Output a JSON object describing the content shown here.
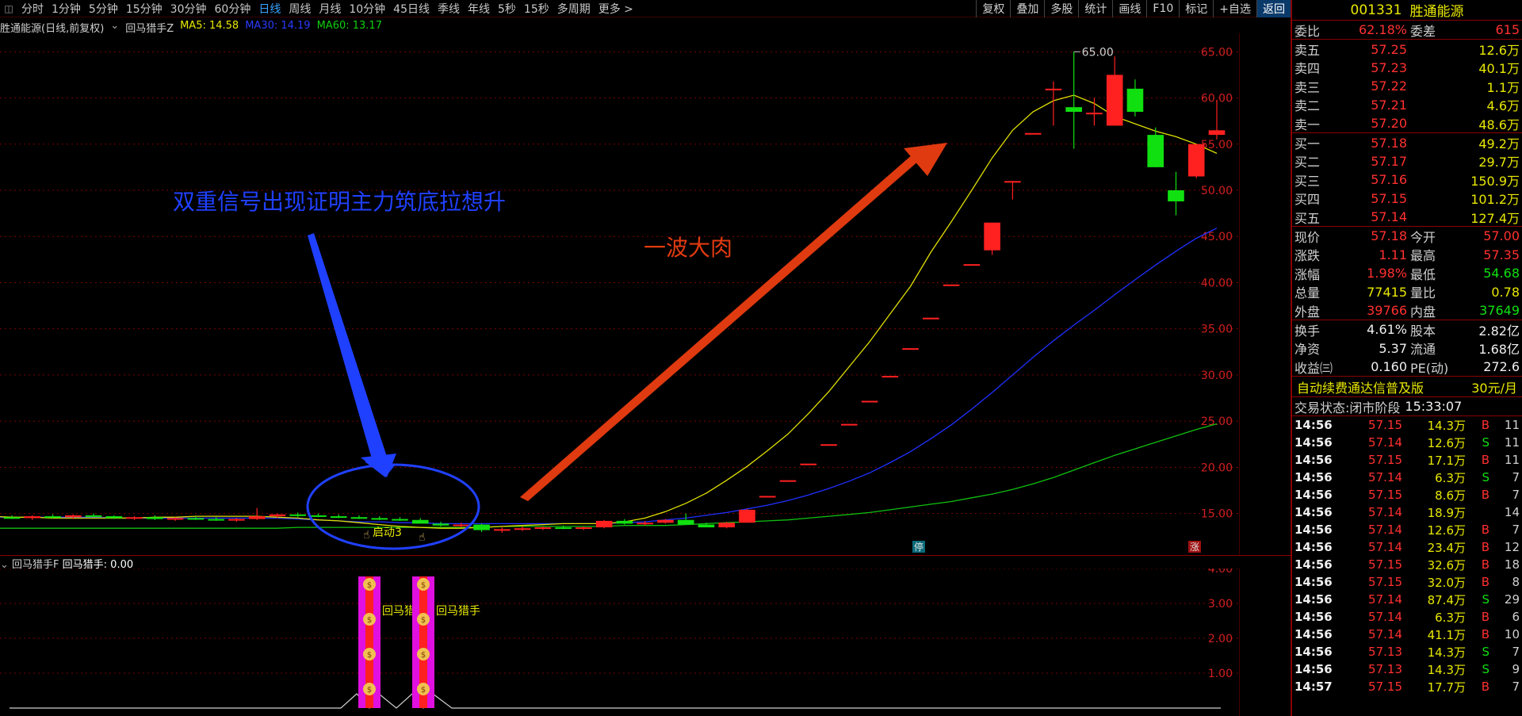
{
  "toolbar": {
    "tabs": [
      "分时",
      "1分钟",
      "5分钟",
      "15分钟",
      "30分钟",
      "60分钟",
      "日线",
      "周线",
      "月线",
      "10分钟",
      "45日线",
      "季线",
      "年线",
      "5秒",
      "15秒",
      "多周期",
      "更多 >"
    ],
    "active_tab": "日线",
    "buttons": [
      "复权",
      "叠加",
      "多股",
      "统计",
      "画线",
      "F10",
      "标记",
      "+自选",
      "返回"
    ]
  },
  "info": {
    "stock_label": "胜通能源(日线,前复权)",
    "indicator_name": "回马猎手Z",
    "ma5": "MA5: 14.58",
    "ma30": "MA30: 14.19",
    "ma60": "MA60: 13.17"
  },
  "sub_panel": {
    "name": "回马猎手F",
    "value_label": "回马猎手: 0.00",
    "signal_labels": [
      "回马猎手",
      "回马猎手"
    ],
    "ylabels": [
      "4.00",
      "3.00",
      "2.00",
      "1.00"
    ]
  },
  "chart_data": {
    "type": "candlestick",
    "ylabels": [
      "65.00",
      "60.00",
      "55.00",
      "50.00",
      "45.00",
      "40.00",
      "35.00",
      "30.00",
      "25.00",
      "20.00",
      "15.00"
    ],
    "ylim": [
      10.5,
      67
    ],
    "high_marker": "65.00",
    "annotations": {
      "blue_text": "双重信号出现证明主力筑底拉想升",
      "red_text": "一波大肉",
      "start_label": "启动3",
      "stop_badge": "停",
      "up_badge": "涨"
    },
    "candles": [
      [
        14.6,
        14.8,
        14.4,
        14.5
      ],
      [
        14.5,
        14.8,
        14.3,
        14.7
      ],
      [
        14.7,
        14.9,
        14.5,
        14.6
      ],
      [
        14.6,
        14.9,
        14.4,
        14.8
      ],
      [
        14.8,
        15.0,
        14.6,
        14.7
      ],
      [
        14.7,
        14.8,
        14.4,
        14.5
      ],
      [
        14.5,
        14.7,
        14.3,
        14.6
      ],
      [
        14.6,
        14.8,
        14.3,
        14.4
      ],
      [
        14.4,
        14.6,
        14.2,
        14.5
      ],
      [
        14.5,
        14.7,
        14.3,
        14.4
      ],
      [
        14.4,
        14.6,
        14.2,
        14.3
      ],
      [
        14.3,
        14.5,
        14.1,
        14.4
      ],
      [
        14.4,
        15.6,
        14.3,
        14.7
      ],
      [
        14.7,
        15.0,
        14.5,
        14.9
      ],
      [
        14.9,
        15.1,
        14.6,
        14.8
      ],
      [
        14.8,
        15.0,
        14.6,
        14.7
      ],
      [
        14.7,
        14.9,
        14.5,
        14.6
      ],
      [
        14.6,
        14.8,
        14.4,
        14.5
      ],
      [
        14.5,
        14.7,
        14.3,
        14.4
      ],
      [
        14.4,
        14.6,
        14.2,
        14.3
      ],
      [
        14.3,
        14.5,
        14.0,
        13.9
      ],
      [
        13.9,
        14.1,
        13.6,
        13.7
      ],
      [
        13.7,
        14.0,
        13.5,
        13.8
      ],
      [
        13.8,
        13.9,
        13.0,
        13.2
      ],
      [
        13.2,
        13.5,
        12.9,
        13.3
      ],
      [
        13.3,
        13.6,
        13.1,
        13.4
      ],
      [
        13.4,
        13.6,
        13.2,
        13.5
      ],
      [
        13.5,
        13.7,
        13.3,
        13.4
      ],
      [
        13.4,
        13.6,
        13.2,
        13.5
      ],
      [
        13.5,
        14.3,
        13.4,
        14.2
      ],
      [
        14.2,
        14.4,
        13.8,
        13.9
      ],
      [
        13.9,
        14.2,
        13.7,
        14.0
      ],
      [
        14.0,
        14.4,
        13.9,
        14.3
      ],
      [
        14.3,
        15.0,
        13.9,
        13.8
      ],
      [
        13.8,
        14.0,
        13.5,
        13.5
      ],
      [
        13.5,
        14.1,
        13.4,
        14.0
      ],
      [
        14.0,
        15.5,
        14.0,
        15.4
      ],
      [
        16.9,
        16.9,
        16.9,
        16.9
      ],
      [
        18.6,
        18.6,
        18.6,
        18.6
      ],
      [
        20.4,
        20.4,
        20.4,
        20.4
      ],
      [
        22.5,
        22.5,
        22.5,
        22.5
      ],
      [
        24.7,
        24.7,
        24.7,
        24.7
      ],
      [
        27.2,
        27.2,
        27.2,
        27.2
      ],
      [
        29.9,
        29.9,
        29.9,
        29.9
      ],
      [
        32.9,
        32.9,
        32.9,
        32.9
      ],
      [
        36.2,
        36.2,
        36.2,
        36.2
      ],
      [
        39.8,
        39.8,
        39.8,
        39.8
      ],
      [
        42.0,
        42.0,
        42.0,
        42.0
      ],
      [
        43.5,
        46.5,
        43.0,
        46.5
      ],
      [
        51.0,
        51.0,
        49.0,
        51.0
      ],
      [
        56.2,
        56.2,
        56.2,
        56.2
      ],
      [
        61.0,
        61.8,
        57.0,
        61.0
      ],
      [
        59.0,
        65.0,
        54.5,
        58.5
      ],
      [
        58.4,
        60.0,
        57.0,
        58.4
      ],
      [
        57.0,
        64.5,
        57.0,
        62.5
      ],
      [
        61.0,
        62.0,
        58.0,
        58.5
      ],
      [
        56.0,
        56.8,
        52.5,
        52.5
      ],
      [
        50.0,
        52.0,
        47.3,
        48.8
      ],
      [
        51.5,
        55.0,
        51.3,
        55.0
      ],
      [
        56.0,
        59.8,
        55.5,
        56.5
      ]
    ],
    "ma5": [
      14.8,
      14.8,
      14.7,
      14.7,
      14.7,
      14.7,
      14.6,
      14.6,
      14.5,
      14.5,
      14.5,
      14.5,
      14.5,
      14.6,
      14.6,
      14.7,
      14.7,
      14.7,
      14.7,
      14.6,
      14.5,
      14.3,
      14.2,
      14.0,
      13.8,
      13.6,
      13.5,
      13.4,
      13.4,
      13.5,
      13.6,
      13.7,
      13.8,
      13.9,
      13.9,
      13.9,
      14.1,
      14.5,
      15.2,
      16.1,
      17.2,
      18.6,
      20.1,
      21.8,
      23.6,
      25.8,
      28.2,
      30.9,
      33.6,
      36.6,
      39.6,
      43.3,
      46.6,
      50.0,
      53.5,
      56.5,
      58.5,
      59.7,
      60.3,
      59.4,
      58.0,
      57.2,
      56.4,
      55.8,
      55.0,
      54.0
    ],
    "ma30": [
      14.6,
      14.6,
      14.6,
      14.6,
      14.6,
      14.6,
      14.6,
      14.6,
      14.6,
      14.6,
      14.6,
      14.5,
      14.5,
      14.5,
      14.5,
      14.5,
      14.5,
      14.5,
      14.5,
      14.5,
      14.4,
      14.3,
      14.2,
      14.1,
      14.1,
      14.0,
      14.0,
      13.9,
      13.9,
      13.9,
      13.9,
      13.9,
      13.9,
      13.9,
      13.9,
      13.9,
      14.0,
      14.1,
      14.3,
      14.5,
      14.8,
      15.1,
      15.5,
      15.9,
      16.4,
      17.0,
      17.7,
      18.5,
      19.4,
      20.5,
      21.7,
      23.1,
      24.6,
      26.3,
      28.1,
      30.0,
      31.9,
      33.7,
      35.4,
      37.0,
      38.7,
      40.3,
      41.9,
      43.4,
      44.8,
      45.9
    ],
    "ma60": [
      13.4,
      13.4,
      13.4,
      13.4,
      13.4,
      13.4,
      13.4,
      13.4,
      13.4,
      13.4,
      13.4,
      13.4,
      13.4,
      13.4,
      13.4,
      13.4,
      13.4,
      13.5,
      13.5,
      13.5,
      13.5,
      13.5,
      13.5,
      13.5,
      13.5,
      13.5,
      13.5,
      13.6,
      13.6,
      13.6,
      13.6,
      13.6,
      13.6,
      13.7,
      13.7,
      13.7,
      13.8,
      13.9,
      14.0,
      14.1,
      14.2,
      14.3,
      14.5,
      14.7,
      14.9,
      15.1,
      15.4,
      15.7,
      16.0,
      16.3,
      16.7,
      17.1,
      17.6,
      18.2,
      18.9,
      19.7,
      20.5,
      21.3,
      22.0,
      22.7,
      23.4,
      24.1,
      24.7
    ]
  },
  "quote": {
    "code": "001331",
    "name": "胜通能源",
    "weibi_label": "委比",
    "weibi": "62.18%",
    "weicha_label": "委差",
    "weicha": "615",
    "asks": [
      {
        "label": "卖五",
        "price": "57.25",
        "vol": "12.6万"
      },
      {
        "label": "卖四",
        "price": "57.23",
        "vol": "40.1万"
      },
      {
        "label": "卖三",
        "price": "57.22",
        "vol": "1.1万"
      },
      {
        "label": "卖二",
        "price": "57.21",
        "vol": "4.6万"
      },
      {
        "label": "卖一",
        "price": "57.20",
        "vol": "48.6万"
      }
    ],
    "bids": [
      {
        "label": "买一",
        "price": "57.18",
        "vol": "49.2万"
      },
      {
        "label": "买二",
        "price": "57.17",
        "vol": "29.7万"
      },
      {
        "label": "买三",
        "price": "57.16",
        "vol": "150.9万"
      },
      {
        "label": "买四",
        "price": "57.15",
        "vol": "101.2万"
      },
      {
        "label": "买五",
        "price": "57.14",
        "vol": "127.4万"
      }
    ],
    "stats1": [
      {
        "l1": "现价",
        "v1": "57.18",
        "l2": "今开",
        "v2": "57.00",
        "c1": "red",
        "c2": "red"
      },
      {
        "l1": "涨跌",
        "v1": "1.11",
        "l2": "最高",
        "v2": "57.35",
        "c1": "red",
        "c2": "red"
      },
      {
        "l1": "涨幅",
        "v1": "1.98%",
        "l2": "最低",
        "v2": "54.68",
        "c1": "red",
        "c2": "green"
      },
      {
        "l1": "总量",
        "v1": "77415",
        "l2": "量比",
        "v2": "0.78",
        "c1": "yellow",
        "c2": "yellow"
      },
      {
        "l1": "外盘",
        "v1": "39766",
        "l2": "内盘",
        "v2": "37649",
        "c1": "red",
        "c2": "green"
      }
    ],
    "stats2": [
      {
        "l1": "换手",
        "v1": "4.61%",
        "l2": "股本",
        "v2": "2.82亿",
        "c1": "white",
        "c2": "white"
      },
      {
        "l1": "净资",
        "v1": "5.37",
        "l2": "流通",
        "v2": "1.68亿",
        "c1": "white",
        "c2": "white"
      },
      {
        "l1": "收益㈢",
        "v1": "0.160",
        "l2": "PE(动)",
        "v2": "272.6",
        "c1": "white",
        "c2": "white"
      }
    ],
    "promo_text": "自动续费通达信普及版",
    "promo_price": "30元/月",
    "trade_state_label": "交易状态:",
    "trade_state": "闭市阶段",
    "trade_time": "15:33:07",
    "ticks": [
      {
        "t": "14:56",
        "p": "57.15",
        "v": "14.3万",
        "d": "B",
        "n": "11"
      },
      {
        "t": "14:56",
        "p": "57.14",
        "v": "12.6万",
        "d": "S",
        "n": "11"
      },
      {
        "t": "14:56",
        "p": "57.15",
        "v": "17.1万",
        "d": "B",
        "n": "11"
      },
      {
        "t": "14:56",
        "p": "57.14",
        "v": "6.3万",
        "d": "S",
        "n": "7"
      },
      {
        "t": "14:56",
        "p": "57.15",
        "v": "8.6万",
        "d": "B",
        "n": "7"
      },
      {
        "t": "14:56",
        "p": "57.14",
        "v": "18.9万",
        "d": "",
        "n": "14"
      },
      {
        "t": "14:56",
        "p": "57.14",
        "v": "12.6万",
        "d": "B",
        "n": "7"
      },
      {
        "t": "14:56",
        "p": "57.14",
        "v": "23.4万",
        "d": "B",
        "n": "12"
      },
      {
        "t": "14:56",
        "p": "57.15",
        "v": "32.6万",
        "d": "B",
        "n": "18"
      },
      {
        "t": "14:56",
        "p": "57.15",
        "v": "32.0万",
        "d": "B",
        "n": "8"
      },
      {
        "t": "14:56",
        "p": "57.14",
        "v": "87.4万",
        "d": "S",
        "n": "29"
      },
      {
        "t": "14:56",
        "p": "57.14",
        "v": "6.3万",
        "d": "B",
        "n": "6"
      },
      {
        "t": "14:56",
        "p": "57.14",
        "v": "41.1万",
        "d": "B",
        "n": "10"
      },
      {
        "t": "14:56",
        "p": "57.13",
        "v": "14.3万",
        "d": "S",
        "n": "7"
      },
      {
        "t": "14:56",
        "p": "57.13",
        "v": "14.3万",
        "d": "S",
        "n": "9"
      },
      {
        "t": "14:57",
        "p": "57.15",
        "v": "17.7万",
        "d": "B",
        "n": "7"
      }
    ]
  }
}
